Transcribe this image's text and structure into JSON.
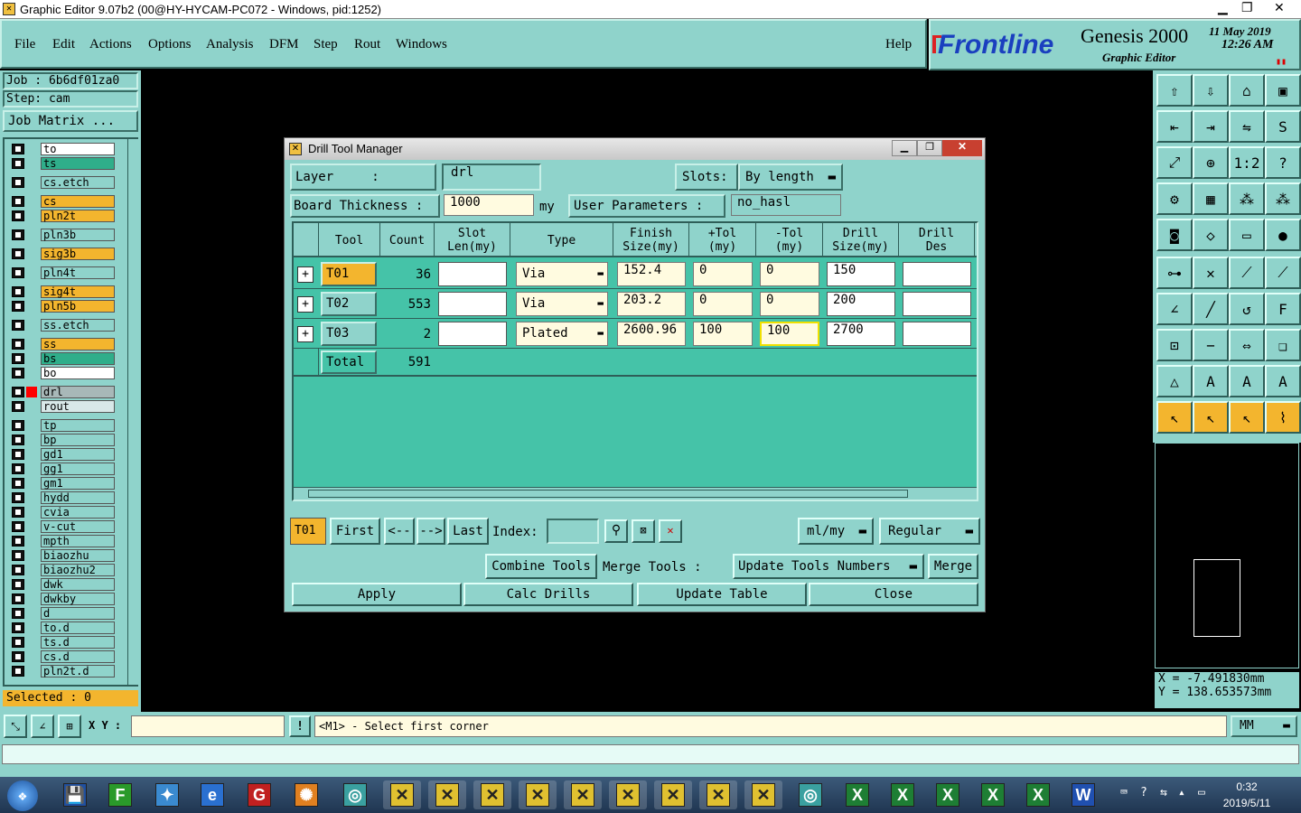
{
  "window": {
    "title": "Graphic Editor 9.07b2 (00@HY-HYCAM-PC072 - Windows, pid:1252)"
  },
  "menu": {
    "items": [
      "File",
      "Edit",
      "Actions",
      "Options",
      "Analysis",
      "DFM",
      "Step",
      "Rout",
      "Windows"
    ],
    "help": "Help"
  },
  "brand": {
    "frontline": "Frontline",
    "genesis": "Genesis 2000",
    "subtitle": "Graphic Editor",
    "date": "11 May 2019",
    "time": "12:26 AM"
  },
  "left": {
    "job": "Job : 6b6df01za0",
    "step": "Step: cam",
    "job_matrix": "Job Matrix ...",
    "selected": "Selected : 0",
    "layers": [
      {
        "n": "to",
        "c": "#ffffff"
      },
      {
        "n": "ts",
        "c": "#2fae8a"
      },
      {
        "n": "cs.etch",
        "c": "#8fd3cb"
      },
      {
        "n": "cs",
        "c": "#f3b52e"
      },
      {
        "n": "pln2t",
        "c": "#f3b52e"
      },
      {
        "n": "pln3b",
        "c": "#8fd3cb"
      },
      {
        "n": "sig3b",
        "c": "#f3b52e"
      },
      {
        "n": "pln4t",
        "c": "#8fd3cb"
      },
      {
        "n": "sig4t",
        "c": "#f3b52e"
      },
      {
        "n": "pln5b",
        "c": "#f3b52e"
      },
      {
        "n": "ss.etch",
        "c": "#8fd3cb"
      },
      {
        "n": "ss",
        "c": "#f3b52e"
      },
      {
        "n": "bs",
        "c": "#2fae8a"
      },
      {
        "n": "bo",
        "c": "#ffffff"
      },
      {
        "n": "drl",
        "c": "#a8b8b8"
      },
      {
        "n": "rout",
        "c": "#d8e8e8"
      },
      {
        "n": "tp",
        "c": "#8fd3cb"
      },
      {
        "n": "bp",
        "c": "#8fd3cb"
      },
      {
        "n": "gd1",
        "c": "#8fd3cb"
      },
      {
        "n": "gg1",
        "c": "#8fd3cb"
      },
      {
        "n": "gm1",
        "c": "#8fd3cb"
      },
      {
        "n": "hydd",
        "c": "#8fd3cb"
      },
      {
        "n": "cvia",
        "c": "#8fd3cb"
      },
      {
        "n": "v-cut",
        "c": "#8fd3cb"
      },
      {
        "n": "mpth",
        "c": "#8fd3cb"
      },
      {
        "n": "biaozhu",
        "c": "#8fd3cb"
      },
      {
        "n": "biaozhu2",
        "c": "#8fd3cb"
      },
      {
        "n": "dwk",
        "c": "#8fd3cb"
      },
      {
        "n": "dwkby",
        "c": "#8fd3cb"
      },
      {
        "n": "d",
        "c": "#8fd3cb"
      },
      {
        "n": "to.d",
        "c": "#8fd3cb"
      },
      {
        "n": "ts.d",
        "c": "#8fd3cb"
      },
      {
        "n": "cs.d",
        "c": "#8fd3cb"
      },
      {
        "n": "pln2t.d",
        "c": "#8fd3cb"
      }
    ]
  },
  "dialog": {
    "title": "Drill Tool Manager",
    "layer_label": "Layer     :",
    "layer_value": "drl",
    "slots_label": "Slots:",
    "slots_value": "By length",
    "thickness_label": "Board Thickness :",
    "thickness_value": "1000",
    "thickness_unit": "my",
    "user_params_label": "User Parameters :",
    "user_params_value": "no_hasl",
    "headers": [
      "Tool",
      "Count",
      "Slot\nLen(my)",
      "Type",
      "Finish\nSize(my)",
      "+Tol\n(my)",
      "-Tol\n(my)",
      "Drill\nSize(my)",
      "Drill\nDes"
    ],
    "rows": [
      {
        "tool": "T01",
        "count": "36",
        "type": "Via",
        "finish": "152.4",
        "ptol": "0",
        "mtol": "0",
        "drill": "150"
      },
      {
        "tool": "T02",
        "count": "553",
        "type": "Via",
        "finish": "203.2",
        "ptol": "0",
        "mtol": "0",
        "drill": "200"
      },
      {
        "tool": "T03",
        "count": "2",
        "type": "Plated",
        "finish": "2600.96",
        "ptol": "100",
        "mtol": "100",
        "drill": "2700"
      }
    ],
    "total_label": "Total",
    "total_value": "591",
    "current_tool": "T01",
    "first": "First",
    "prev": "<--",
    "next": "-->",
    "last": "Last",
    "index_label": "Index:",
    "units": "ml/my",
    "mode": "Regular",
    "combine": "Combine Tools",
    "merge_label": "Merge Tools :",
    "update_numbers": "Update Tools Numbers",
    "merge": "Merge",
    "apply": "Apply",
    "calc": "Calc Drills",
    "update_table": "Update Table",
    "close": "Close"
  },
  "coords": {
    "x": "X = -7.491830mm",
    "y": "Y = 138.653573mm"
  },
  "status": {
    "xy_label": "X Y :",
    "message": "<M1> - Select first corner",
    "unit": "MM"
  },
  "clock": {
    "time": "0:32",
    "date": "2019/5/11"
  }
}
